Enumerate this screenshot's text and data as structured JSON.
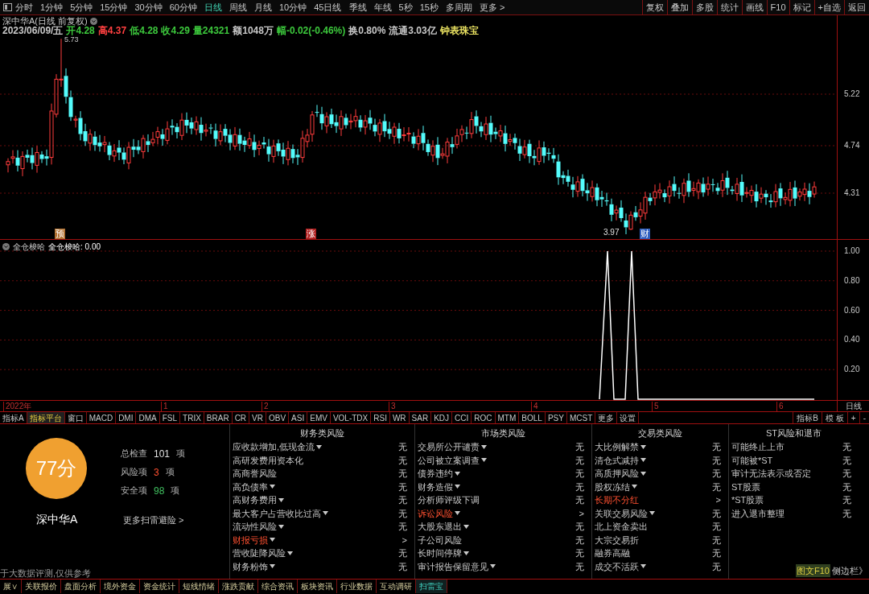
{
  "toolbar": {
    "periods": [
      {
        "label": "分时",
        "selected": false
      },
      {
        "label": "1分钟",
        "selected": false
      },
      {
        "label": "5分钟",
        "selected": false
      },
      {
        "label": "15分钟",
        "selected": false
      },
      {
        "label": "30分钟",
        "selected": false
      },
      {
        "label": "60分钟",
        "selected": false
      },
      {
        "label": "日线",
        "selected": true
      },
      {
        "label": "周线",
        "selected": false
      },
      {
        "label": "月线",
        "selected": false
      },
      {
        "label": "10分钟",
        "selected": false
      },
      {
        "label": "45日线",
        "selected": false
      },
      {
        "label": "季线",
        "selected": false
      },
      {
        "label": "年线",
        "selected": false
      },
      {
        "label": "5秒",
        "selected": false
      },
      {
        "label": "15秒",
        "selected": false
      },
      {
        "label": "多周期",
        "selected": false
      },
      {
        "label": "更多 >",
        "selected": false
      }
    ],
    "buttons": [
      "复权",
      "叠加",
      "多股",
      "统计",
      "画线",
      "F10",
      "标记",
      "+自选",
      "返回"
    ]
  },
  "chart": {
    "title": "深中华A(日线 前复权)",
    "quote": [
      {
        "text": "2023/06/09/五",
        "color": "#c8c8c8"
      },
      {
        "text": "开4.28",
        "color": "#3cc83c"
      },
      {
        "text": "高4.37",
        "color": "#ff4040"
      },
      {
        "text": "低4.28",
        "color": "#3cc83c"
      },
      {
        "text": "收4.29",
        "color": "#3cc83c"
      },
      {
        "text": "量24321",
        "color": "#3cc83c"
      },
      {
        "text": "额1048万",
        "color": "#c8c8c8"
      },
      {
        "text": "幅-0.02(-0.46%)",
        "color": "#3cc83c"
      },
      {
        "text": "换0.80%",
        "color": "#c8c8c8"
      },
      {
        "text": "流通3.03亿",
        "color": "#c8c8c8"
      },
      {
        "text": "钟表珠宝",
        "color": "#e8e060"
      }
    ],
    "high_label": "5.73",
    "low_label": "3.97",
    "markers": [
      {
        "text": "预",
        "color": "#b07030"
      },
      {
        "text": "涨",
        "color": "#b02020"
      },
      {
        "text": "财",
        "color": "#3060c0"
      }
    ],
    "price_axis": [
      "5.22",
      "4.74",
      "4.31"
    ]
  },
  "indicator": {
    "name": "全仓梭哈",
    "reading": "全仓梭哈: 0.00",
    "axis": [
      "1.00",
      "0.80",
      "0.60",
      "0.40",
      "0.20"
    ]
  },
  "date_axis": [
    "2022年",
    "1",
    "2",
    "3",
    "4",
    "5",
    "6"
  ],
  "period_label": "日线",
  "indicator_tabs": [
    {
      "label": "指标A",
      "selected": false
    },
    {
      "label": "指标平台",
      "selected": true
    },
    {
      "label": "窗口",
      "selected": false
    },
    {
      "label": "MACD",
      "selected": false
    },
    {
      "label": "DMI",
      "selected": false
    },
    {
      "label": "DMA",
      "selected": false
    },
    {
      "label": "FSL",
      "selected": false
    },
    {
      "label": "TRIX",
      "selected": false
    },
    {
      "label": "BRAR",
      "selected": false
    },
    {
      "label": "CR",
      "selected": false
    },
    {
      "label": "VR",
      "selected": false
    },
    {
      "label": "OBV",
      "selected": false
    },
    {
      "label": "ASI",
      "selected": false
    },
    {
      "label": "EMV",
      "selected": false
    },
    {
      "label": "VOL-TDX",
      "selected": false
    },
    {
      "label": "RSI",
      "selected": false
    },
    {
      "label": "WR",
      "selected": false
    },
    {
      "label": "SAR",
      "selected": false
    },
    {
      "label": "KDJ",
      "selected": false
    },
    {
      "label": "CCI",
      "selected": false
    },
    {
      "label": "ROC",
      "selected": false
    },
    {
      "label": "MTM",
      "selected": false
    },
    {
      "label": "BOLL",
      "selected": false
    },
    {
      "label": "PSY",
      "selected": false
    },
    {
      "label": "MCST",
      "selected": false
    },
    {
      "label": "更多",
      "selected": false
    },
    {
      "label": "设置",
      "selected": false
    }
  ],
  "indicator_right": [
    "指标B",
    "模 板",
    "+",
    "-"
  ],
  "risk_scan": {
    "score": "77分",
    "stock": "深中华A",
    "stats": [
      {
        "label": "总检查",
        "value": "101",
        "unit": "项",
        "kind": "total"
      },
      {
        "label": "风险项",
        "value": "3",
        "unit": "项",
        "kind": "risk"
      },
      {
        "label": "安全项",
        "value": "98",
        "unit": "项",
        "kind": "safe"
      }
    ],
    "more_link": "更多扫雷避险 >",
    "disclaimer": "于大数据评测,仅供参考",
    "columns": [
      {
        "title": "财务类风险",
        "rows": [
          {
            "label": "应收款增加,低现金流",
            "dropdown": true,
            "risk": false,
            "result": "无"
          },
          {
            "label": "高研发费用资本化",
            "dropdown": false,
            "risk": false,
            "result": "无"
          },
          {
            "label": "高商誉风险",
            "dropdown": false,
            "risk": false,
            "result": "无"
          },
          {
            "label": "高负债率",
            "dropdown": true,
            "risk": false,
            "result": "无"
          },
          {
            "label": "高财务费用",
            "dropdown": true,
            "risk": false,
            "result": "无"
          },
          {
            "label": "最大客户占营收比过高",
            "dropdown": true,
            "risk": false,
            "result": "无"
          },
          {
            "label": "流动性风险",
            "dropdown": true,
            "risk": false,
            "result": "无"
          },
          {
            "label": "财报亏损",
            "dropdown": true,
            "risk": true,
            "result": ">"
          },
          {
            "label": "营收陡降风险",
            "dropdown": true,
            "risk": false,
            "result": "无"
          },
          {
            "label": "财务粉饰",
            "dropdown": true,
            "risk": false,
            "result": "无"
          }
        ]
      },
      {
        "title": "市场类风险",
        "rows": [
          {
            "label": "交易所公开谴责",
            "dropdown": true,
            "risk": false,
            "result": "无"
          },
          {
            "label": "公司被立案调查",
            "dropdown": true,
            "risk": false,
            "result": "无"
          },
          {
            "label": "债券违约",
            "dropdown": true,
            "risk": false,
            "result": "无"
          },
          {
            "label": "财务造假",
            "dropdown": true,
            "risk": false,
            "result": "无"
          },
          {
            "label": "分析师评级下调",
            "dropdown": false,
            "risk": false,
            "result": "无"
          },
          {
            "label": "诉讼风险",
            "dropdown": true,
            "risk": true,
            "result": ">"
          },
          {
            "label": "大股东退出",
            "dropdown": true,
            "risk": false,
            "result": "无"
          },
          {
            "label": "子公司风险",
            "dropdown": false,
            "risk": false,
            "result": "无"
          },
          {
            "label": "长时间停牌",
            "dropdown": true,
            "risk": false,
            "result": "无"
          },
          {
            "label": "审计报告保留意见",
            "dropdown": true,
            "risk": false,
            "result": "无"
          }
        ]
      },
      {
        "title": "交易类风险",
        "rows": [
          {
            "label": "大比例解禁",
            "dropdown": true,
            "risk": false,
            "result": "无"
          },
          {
            "label": "清仓式减持",
            "dropdown": true,
            "risk": false,
            "result": "无"
          },
          {
            "label": "高质押风险",
            "dropdown": true,
            "risk": false,
            "result": "无"
          },
          {
            "label": "股权冻结",
            "dropdown": true,
            "risk": false,
            "result": "无"
          },
          {
            "label": "长期不分红",
            "dropdown": false,
            "risk": true,
            "result": ">"
          },
          {
            "label": "关联交易风险",
            "dropdown": true,
            "risk": false,
            "result": "无"
          },
          {
            "label": "北上资金卖出",
            "dropdown": false,
            "risk": false,
            "result": "无"
          },
          {
            "label": "大宗交易折",
            "dropdown": false,
            "risk": false,
            "result": "无"
          },
          {
            "label": "融券高融",
            "dropdown": false,
            "risk": false,
            "result": "无"
          },
          {
            "label": "成交不活跃",
            "dropdown": true,
            "risk": false,
            "result": "无"
          }
        ]
      },
      {
        "title": "ST风险和退市",
        "rows": [
          {
            "label": "可能终止上市",
            "dropdown": false,
            "risk": false,
            "result": "无"
          },
          {
            "label": "可能被*ST",
            "dropdown": false,
            "risk": false,
            "result": "无"
          },
          {
            "label": "审计无法表示或否定",
            "dropdown": false,
            "risk": false,
            "result": "无"
          },
          {
            "label": "ST股票",
            "dropdown": false,
            "risk": false,
            "result": "无"
          },
          {
            "label": "*ST股票",
            "dropdown": false,
            "risk": false,
            "result": "无"
          },
          {
            "label": "进入退市整理",
            "dropdown": false,
            "risk": false,
            "result": "无"
          }
        ]
      }
    ],
    "side_links": [
      "图文F10",
      "侧边栏》"
    ]
  },
  "bottom_tabs": [
    {
      "label": "展∨",
      "selected": false
    },
    {
      "label": "关联报价",
      "selected": false
    },
    {
      "label": "盘面分析",
      "selected": false
    },
    {
      "label": "境外资金",
      "selected": false
    },
    {
      "label": "资金统计",
      "selected": false
    },
    {
      "label": "短线情绪",
      "selected": false
    },
    {
      "label": "涨跌贡献",
      "selected": false
    },
    {
      "label": "综合资讯",
      "selected": false
    },
    {
      "label": "板块资讯",
      "selected": false
    },
    {
      "label": "行业数据",
      "selected": false
    },
    {
      "label": "互动调研",
      "selected": false
    },
    {
      "label": "扫雷宝",
      "selected": true
    }
  ]
}
